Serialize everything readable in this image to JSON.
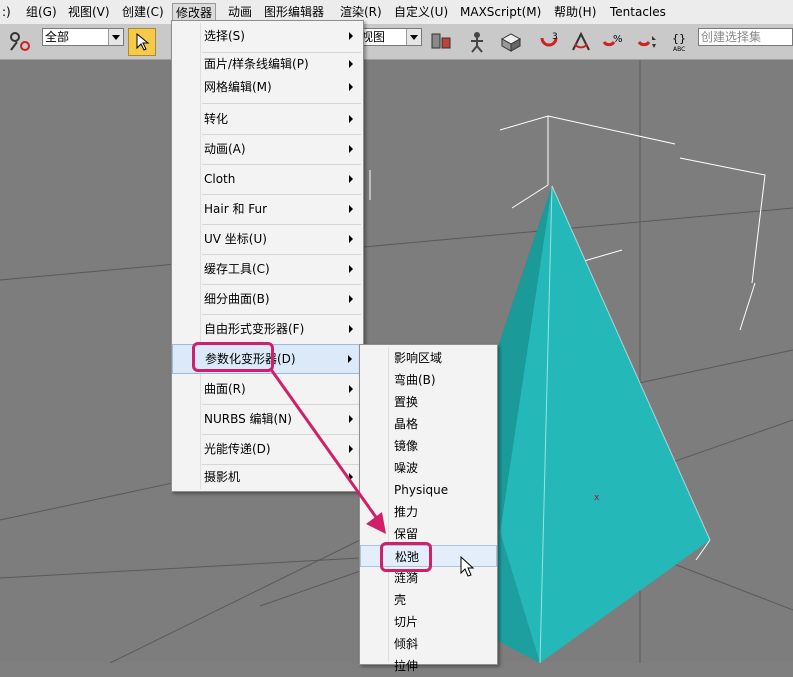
{
  "menubar": {
    "items": [
      ":)",
      "组(G)",
      "视图(V)",
      "创建(C)",
      "修改器",
      "动画",
      "图形编辑器",
      "渲染(R)",
      "自定义(U)",
      "MAXScript(M)",
      "帮助(H)",
      "Tentacles"
    ]
  },
  "toolbar": {
    "selection_filter": "全部",
    "view_combo": "视图",
    "named_selection_placeholder": "创建选择集"
  },
  "modifiers_menu": {
    "items": [
      {
        "label": "选择(S)"
      },
      {
        "label": "面片/样条线编辑(P)"
      },
      {
        "label": "网格编辑(M)"
      },
      {
        "label": "转化"
      },
      {
        "label": "动画(A)"
      },
      {
        "label": "Cloth"
      },
      {
        "label": "Hair 和 Fur"
      },
      {
        "label": "UV 坐标(U)"
      },
      {
        "label": "缓存工具(C)"
      },
      {
        "label": "细分曲面(B)"
      },
      {
        "label": "自由形式变形器(F)"
      },
      {
        "label": "参数化变形器(D)"
      },
      {
        "label": "曲面(R)"
      },
      {
        "label": "NURBS 编辑(N)"
      },
      {
        "label": "光能传递(D)"
      },
      {
        "label": "摄影机"
      }
    ]
  },
  "parametric_submenu": {
    "items": [
      "影响区域",
      "弯曲(B)",
      "置换",
      "晶格",
      "镜像",
      "噪波",
      "Physique",
      "推力",
      "保留",
      "松弛",
      "涟漪",
      "壳",
      "切片",
      "倾斜",
      "拉伸"
    ],
    "highlighted": "松弛"
  },
  "colors": {
    "accent": "#d0206a",
    "pyramid_light": "#24b8b8",
    "pyramid_dark": "#137070",
    "viewport_bg": "#7d7d7d"
  }
}
